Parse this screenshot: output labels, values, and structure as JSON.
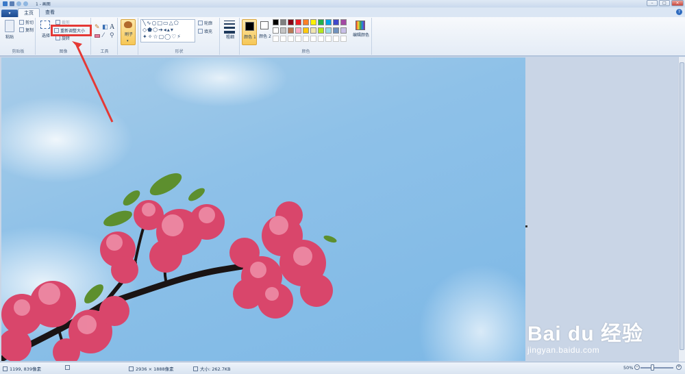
{
  "window": {
    "title": "1 - 画图"
  },
  "tabs": [
    {
      "label": "主页"
    },
    {
      "label": "查看"
    }
  ],
  "clipboard": {
    "paste": "粘贴",
    "cut": "剪切",
    "copy": "复制",
    "group": "剪贴板"
  },
  "image": {
    "select": "选择",
    "crop": "裁剪",
    "resize": "重新调整大小",
    "rotate": "旋转",
    "group": "图像"
  },
  "tools": {
    "group": "工具"
  },
  "brushes": {
    "label": "刷子"
  },
  "shapes": {
    "outline": "轮廓",
    "fill": "填充",
    "group": "形状"
  },
  "size": {
    "label": "粗细"
  },
  "colors": {
    "color1": "颜色 1",
    "color2": "颜色 2",
    "edit": "编辑颜色",
    "group": "颜色",
    "palette_row1": [
      "#000000",
      "#7f7f7f",
      "#880015",
      "#ed1c24",
      "#ff7f27",
      "#fff200",
      "#22b14c",
      "#00a2e8",
      "#3f48cc",
      "#a349a4"
    ],
    "palette_row2": [
      "#ffffff",
      "#c3c3c3",
      "#b97a57",
      "#ffaec9",
      "#ffc90e",
      "#efe4b0",
      "#b5e61d",
      "#99d9ea",
      "#7092be",
      "#c8bfe7"
    ]
  },
  "status": {
    "cursor": "1199, 839像素",
    "image_size": "2936 × 1888像素",
    "file_size": "大小: 262.7KB",
    "zoom": "50%"
  },
  "watermark": {
    "main": "Bai du 经验",
    "sub": "jingyan.baidu.com"
  },
  "accent": "#e53935"
}
